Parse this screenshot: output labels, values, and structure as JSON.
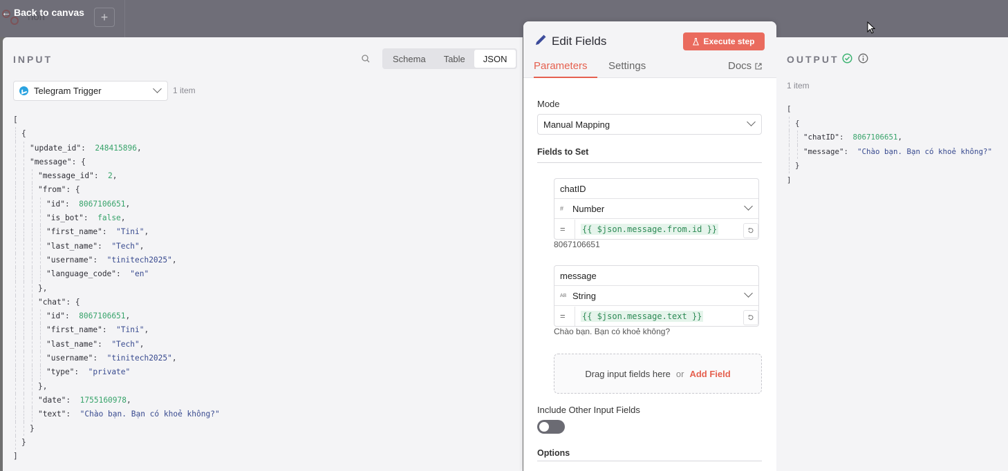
{
  "topbar": {
    "back_label": "Back to canvas",
    "ghost_text": "hôn",
    "plus_label": "+"
  },
  "input": {
    "title": "INPUT",
    "view_tabs": [
      "Schema",
      "Table",
      "JSON"
    ],
    "active_view": "JSON",
    "trigger_node": "Telegram Trigger",
    "item_count": "1 item",
    "json_lines": [
      {
        "indent": 0,
        "parts": [
          [
            "p",
            "["
          ]
        ]
      },
      {
        "indent": 1,
        "parts": [
          [
            "p",
            "{"
          ]
        ]
      },
      {
        "indent": 2,
        "parts": [
          [
            "k",
            "\"update_id\""
          ],
          [
            "p",
            ":  "
          ],
          [
            "n",
            "248415896"
          ],
          [
            "p",
            ","
          ]
        ]
      },
      {
        "indent": 2,
        "parts": [
          [
            "k",
            "\"message\""
          ],
          [
            "p",
            ": {"
          ]
        ]
      },
      {
        "indent": 3,
        "parts": [
          [
            "k",
            "\"message_id\""
          ],
          [
            "p",
            ":  "
          ],
          [
            "n",
            "2"
          ],
          [
            "p",
            ","
          ]
        ]
      },
      {
        "indent": 3,
        "parts": [
          [
            "k",
            "\"from\""
          ],
          [
            "p",
            ": {"
          ]
        ]
      },
      {
        "indent": 4,
        "parts": [
          [
            "k",
            "\"id\""
          ],
          [
            "p",
            ":  "
          ],
          [
            "n",
            "8067106651"
          ],
          [
            "p",
            ","
          ]
        ]
      },
      {
        "indent": 4,
        "parts": [
          [
            "k",
            "\"is_bot\""
          ],
          [
            "p",
            ":  "
          ],
          [
            "b",
            "false"
          ],
          [
            "p",
            ","
          ]
        ]
      },
      {
        "indent": 4,
        "parts": [
          [
            "k",
            "\"first_name\""
          ],
          [
            "p",
            ":  "
          ],
          [
            "s",
            "\"Tini\""
          ],
          [
            "p",
            ","
          ]
        ]
      },
      {
        "indent": 4,
        "parts": [
          [
            "k",
            "\"last_name\""
          ],
          [
            "p",
            ":  "
          ],
          [
            "s",
            "\"Tech\""
          ],
          [
            "p",
            ","
          ]
        ]
      },
      {
        "indent": 4,
        "parts": [
          [
            "k",
            "\"username\""
          ],
          [
            "p",
            ":  "
          ],
          [
            "s",
            "\"tinitech2025\""
          ],
          [
            "p",
            ","
          ]
        ]
      },
      {
        "indent": 4,
        "parts": [
          [
            "k",
            "\"language_code\""
          ],
          [
            "p",
            ":  "
          ],
          [
            "s",
            "\"en\""
          ]
        ]
      },
      {
        "indent": 3,
        "parts": [
          [
            "p",
            "},"
          ]
        ]
      },
      {
        "indent": 3,
        "parts": [
          [
            "k",
            "\"chat\""
          ],
          [
            "p",
            ": {"
          ]
        ]
      },
      {
        "indent": 4,
        "parts": [
          [
            "k",
            "\"id\""
          ],
          [
            "p",
            ":  "
          ],
          [
            "n",
            "8067106651"
          ],
          [
            "p",
            ","
          ]
        ]
      },
      {
        "indent": 4,
        "parts": [
          [
            "k",
            "\"first_name\""
          ],
          [
            "p",
            ":  "
          ],
          [
            "s",
            "\"Tini\""
          ],
          [
            "p",
            ","
          ]
        ]
      },
      {
        "indent": 4,
        "parts": [
          [
            "k",
            "\"last_name\""
          ],
          [
            "p",
            ":  "
          ],
          [
            "s",
            "\"Tech\""
          ],
          [
            "p",
            ","
          ]
        ]
      },
      {
        "indent": 4,
        "parts": [
          [
            "k",
            "\"username\""
          ],
          [
            "p",
            ":  "
          ],
          [
            "s",
            "\"tinitech2025\""
          ],
          [
            "p",
            ","
          ]
        ]
      },
      {
        "indent": 4,
        "parts": [
          [
            "k",
            "\"type\""
          ],
          [
            "p",
            ":  "
          ],
          [
            "s",
            "\"private\""
          ]
        ]
      },
      {
        "indent": 3,
        "parts": [
          [
            "p",
            "},"
          ]
        ]
      },
      {
        "indent": 3,
        "parts": [
          [
            "k",
            "\"date\""
          ],
          [
            "p",
            ":  "
          ],
          [
            "n",
            "1755160978"
          ],
          [
            "p",
            ","
          ]
        ]
      },
      {
        "indent": 3,
        "parts": [
          [
            "k",
            "\"text\""
          ],
          [
            "p",
            ":  "
          ],
          [
            "s",
            "\"Chào bạn. Bạn có khoẻ không?\""
          ]
        ]
      },
      {
        "indent": 2,
        "parts": [
          [
            "p",
            "}"
          ]
        ]
      },
      {
        "indent": 1,
        "parts": [
          [
            "p",
            "}"
          ]
        ]
      },
      {
        "indent": 0,
        "parts": [
          [
            "p",
            "]"
          ]
        ]
      }
    ]
  },
  "modal": {
    "title": "Edit Fields",
    "execute_label": "Execute step",
    "tabs": [
      "Parameters",
      "Settings"
    ],
    "active_tab": "Parameters",
    "docs_label": "Docs",
    "mode_label": "Mode",
    "mode_value": "Manual Mapping",
    "fields_label": "Fields to Set",
    "fields": [
      {
        "name": "chatID",
        "type_icon": "#",
        "type": "Number",
        "expression": "{{ $json.message.from.id }}",
        "preview": "8067106651"
      },
      {
        "name": "message",
        "type_icon": "AB",
        "type": "String",
        "expression": "{{ $json.message.text }}",
        "preview": "Chào bạn. Bạn có khoẻ không?"
      }
    ],
    "drop_text": "Drag input fields here",
    "drop_or": "or",
    "add_field_label": "Add Field",
    "include_label": "Include Other Input Fields",
    "include_on": false,
    "options_label": "Options"
  },
  "output": {
    "title": "OUTPUT",
    "item_count": "1 item",
    "json_lines": [
      {
        "indent": 0,
        "parts": [
          [
            "p",
            "["
          ]
        ]
      },
      {
        "indent": 1,
        "parts": [
          [
            "p",
            "{"
          ]
        ]
      },
      {
        "indent": 2,
        "parts": [
          [
            "k",
            "\"chatID\""
          ],
          [
            "p",
            ":  "
          ],
          [
            "n",
            "8067106651"
          ],
          [
            "p",
            ","
          ]
        ]
      },
      {
        "indent": 2,
        "parts": [
          [
            "k",
            "\"message\""
          ],
          [
            "p",
            ":  "
          ],
          [
            "s",
            "\"Chào bạn. Bạn có khoẻ không?\""
          ]
        ]
      },
      {
        "indent": 1,
        "parts": [
          [
            "p",
            "}"
          ]
        ]
      },
      {
        "indent": 0,
        "parts": [
          [
            "p",
            "]"
          ]
        ]
      }
    ]
  },
  "colors": {
    "accent": "#e5604f",
    "execute_button": "#ea6b5e",
    "json_number": "#37a36a",
    "json_string": "#384a8f",
    "success": "#3cb371",
    "telegram": "#2aa3e0"
  }
}
